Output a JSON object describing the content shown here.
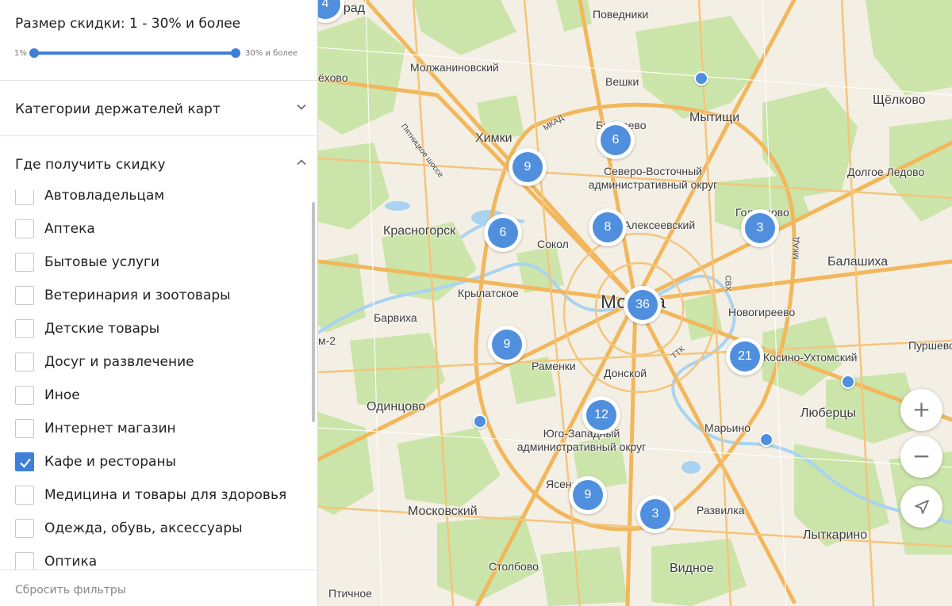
{
  "discount": {
    "title": "Размер скидки: 1 - 30% и более",
    "min_label": "1%",
    "max_label": "30% и более",
    "range": [
      1,
      30
    ]
  },
  "sections": {
    "categories": {
      "title": "Категории держателей карт",
      "state": "collapsed"
    },
    "where": {
      "title": "Где получить скидку",
      "state": "expanded"
    }
  },
  "where_items": [
    {
      "label": "Автовладельцам",
      "checked": false
    },
    {
      "label": "Аптека",
      "checked": false
    },
    {
      "label": "Бытовые услуги",
      "checked": false
    },
    {
      "label": "Ветеринария и зоотовары",
      "checked": false
    },
    {
      "label": "Детские товары",
      "checked": false
    },
    {
      "label": "Досуг и развлечение",
      "checked": false
    },
    {
      "label": "Иное",
      "checked": false
    },
    {
      "label": "Интернет магазин",
      "checked": false
    },
    {
      "label": "Кафе и рестораны",
      "checked": true
    },
    {
      "label": "Медицина и товары для здоровья",
      "checked": false
    },
    {
      "label": "Одежда, обувь, аксессуары",
      "checked": false
    },
    {
      "label": "Оптика",
      "checked": false
    }
  ],
  "reset_label": "Сбросить фильтры",
  "map": {
    "labels": {
      "grad": "град",
      "povedniki": "Поведники",
      "ozhovo": "ёхово",
      "molzhaninovsky": "Молжаниновский",
      "veshki": "Вешки",
      "shchelkovo": "Щёлково",
      "bibirevo": "Бибирево",
      "mytishchi": "Мытищи",
      "mkad_n": "МКАД",
      "pyatnitskoe": "Пятницкое шоссе",
      "khimki": "Химки",
      "sv_okrug": "Северо-Восточный административный округ",
      "dolgoe_ledovo": "Долгое Ледово",
      "golyanovo": "Гольяново",
      "krasnogorsk": "Красногорск",
      "alekseevsky": "Алексеевский",
      "mkad_e": "МКАД",
      "sokol": "Сокол",
      "balashikha": "Балашиха",
      "svh": "СВХ",
      "krylatskoe": "Крылатское",
      "moskva": "Москва",
      "barvikha": "Барвиха",
      "novogireevo": "Новогиреево",
      "m2": "м-2",
      "ttk": "ТТК",
      "purshevo": "Пуршево",
      "ramenki": "Раменки",
      "donskoy": "Донской",
      "kosino": "Косино-Ухтомский",
      "odintsovo": "Одинцово",
      "lyubertsy": "Люберцы",
      "yz_okrug": "Юго-Западный административный округ",
      "marino": "Марьино",
      "yasenevo": "Ясенево",
      "moskovsky": "Московский",
      "razvilka": "Развилка",
      "lytkarino": "Лыткарино",
      "stolbovo": "Столбово",
      "vidnoe": "Видное",
      "ptichnoe": "Птичное"
    },
    "clusters": [
      {
        "count": "4"
      },
      {
        "count": "6"
      },
      {
        "count": "9"
      },
      {
        "count": "6"
      },
      {
        "count": "8"
      },
      {
        "count": "3"
      },
      {
        "count": "36"
      },
      {
        "count": "9"
      },
      {
        "count": "21"
      },
      {
        "count": "12"
      },
      {
        "count": "9"
      },
      {
        "count": "3"
      }
    ],
    "controls": {
      "zoom_in": "+",
      "zoom_out": "−",
      "locate_icon": "navigation-arrow-icon"
    },
    "colors": {
      "cluster": "#4f8fde",
      "road": "#f2b75c",
      "green": "#c9e4a6",
      "water": "#a9d3f1",
      "background": "#f4efe4"
    }
  }
}
